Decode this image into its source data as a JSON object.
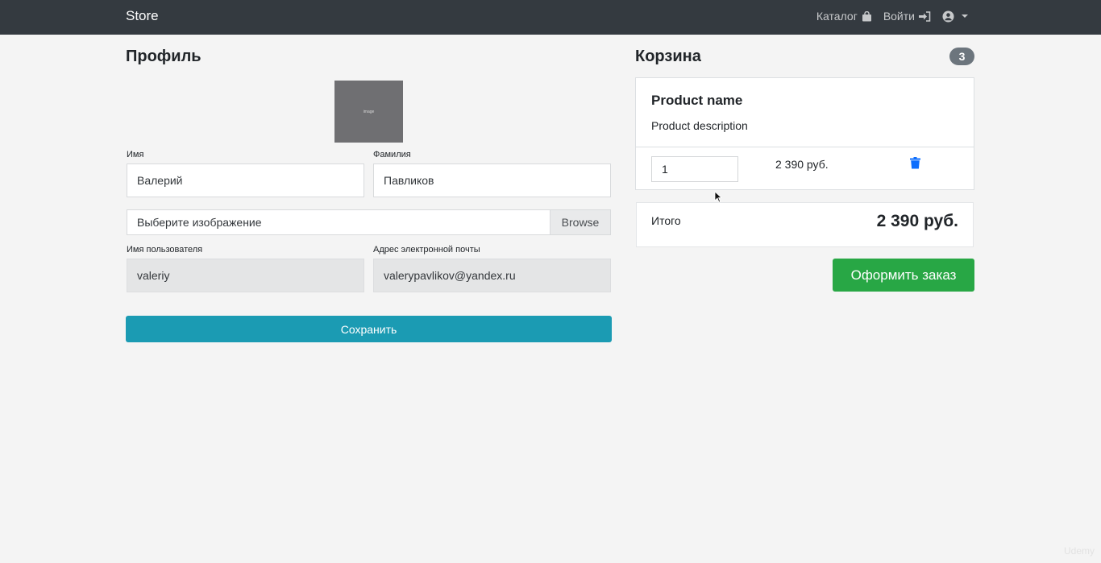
{
  "navbar": {
    "brand": "Store",
    "catalog_label": "Каталог",
    "login_label": "Войти"
  },
  "profile": {
    "title": "Профиль",
    "avatar_text": "image",
    "first_name_label": "Имя",
    "first_name_value": "Валерий",
    "last_name_label": "Фамилия",
    "last_name_value": "Павликов",
    "file_placeholder": "Выберите изображение",
    "file_button": "Browse",
    "username_label": "Имя пользователя",
    "username_value": "valeriy",
    "email_label": "Адрес электронной почты",
    "email_value": "valerypavlikov@yandex.ru",
    "save_label": "Сохранить"
  },
  "cart": {
    "title": "Корзина",
    "count": "3",
    "item": {
      "name": "Product name",
      "description": "Product description",
      "quantity": "1",
      "price": "2 390 руб."
    },
    "total_label": "Итого",
    "total_value": "2 390 руб.",
    "order_label": "Оформить заказ"
  },
  "watermark": "Udemy",
  "colors": {
    "navbar": "#343a40",
    "save_button": "#1b9bb3",
    "order_button": "#28a745",
    "badge": "#6c757d",
    "trash_icon": "#0d6efd"
  },
  "icons": [
    "shopping-bag-icon",
    "sign-in-icon",
    "user-circle-icon",
    "chevron-down-icon",
    "trash-icon",
    "mouse-cursor-icon"
  ]
}
